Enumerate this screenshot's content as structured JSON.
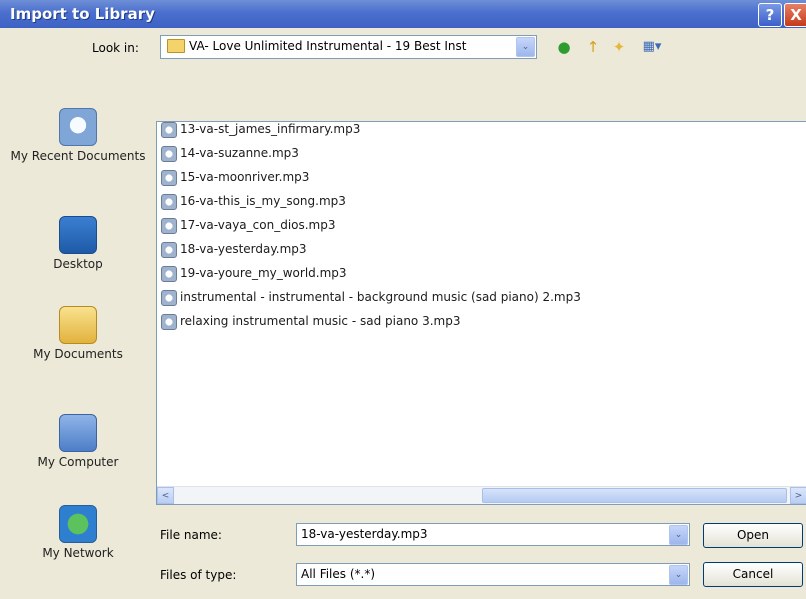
{
  "window": {
    "title": "Import to Library",
    "help_glyph": "?",
    "close_glyph": "X"
  },
  "lookin": {
    "label": "Look in:",
    "value": "VA- Love Unlimited Instrumental - 19 Best Inst",
    "arrow": "⌄"
  },
  "toolbar": {
    "back_glyph": "●",
    "up_glyph": "↑",
    "newfolder_glyph": "✦",
    "views_glyph": "▦▾"
  },
  "places": [
    {
      "label": "My Recent Documents",
      "icon": "recent-documents-icon"
    },
    {
      "label": "Desktop",
      "icon": "desktop-icon"
    },
    {
      "label": "My Documents",
      "icon": "my-documents-icon"
    },
    {
      "label": "My Computer",
      "icon": "my-computer-icon"
    },
    {
      "label": "My Network",
      "icon": "my-network-icon"
    }
  ],
  "files": [
    "13-va-st_james_infirmary.mp3",
    "14-va-suzanne.mp3",
    "15-va-moonriver.mp3",
    "16-va-this_is_my_song.mp3",
    "17-va-vaya_con_dios.mp3",
    "18-va-yesterday.mp3",
    "19-va-youre_my_world.mp3",
    "instrumental - instrumental - background music (sad piano)  2.mp3",
    "relaxing instrumental music - sad piano  3.mp3"
  ],
  "scroll": {
    "left_glyph": "<",
    "right_glyph": ">"
  },
  "form": {
    "filename_label": "File name:",
    "filename_value": "18-va-yesterday.mp3",
    "filetype_label": "Files of type:",
    "filetype_value": "All Files (*.*)"
  },
  "buttons": {
    "open": "Open",
    "cancel": "Cancel"
  }
}
